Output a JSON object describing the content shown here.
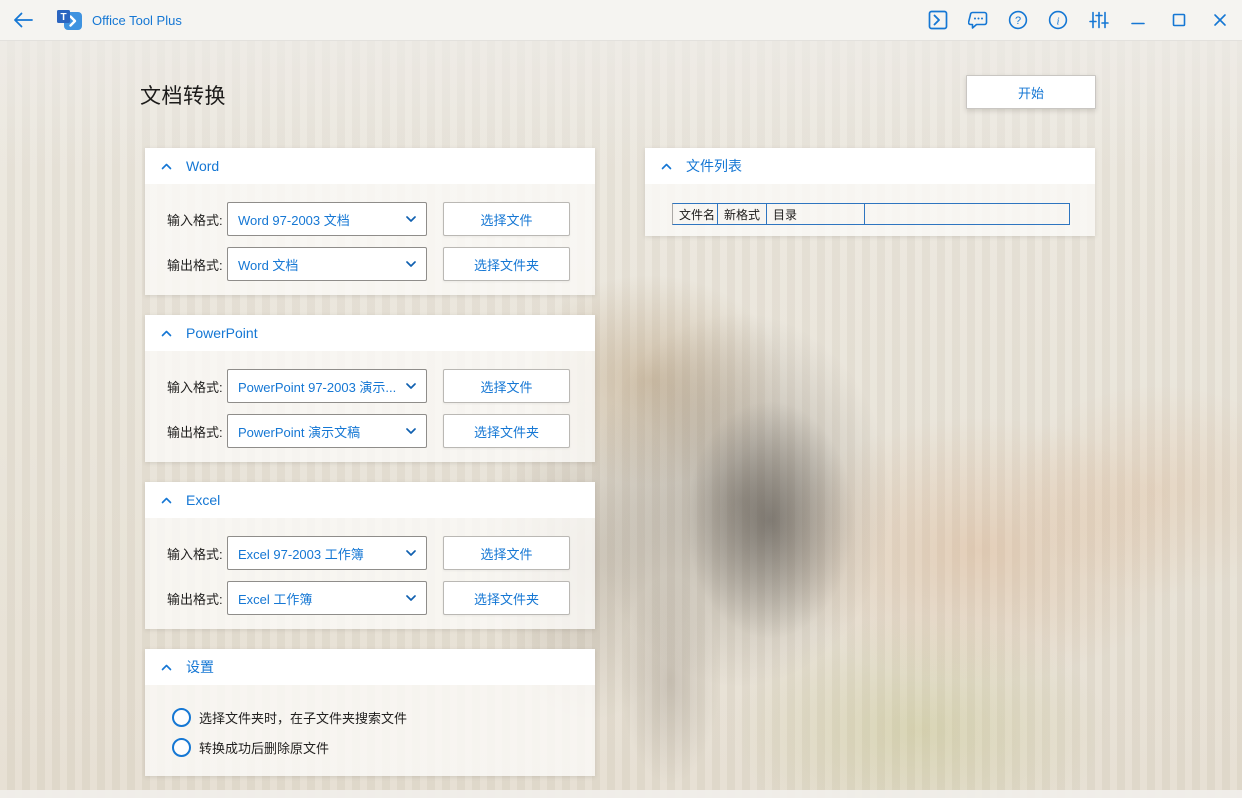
{
  "titlebar": {
    "app_title": "Office Tool Plus",
    "logo_letter": "T",
    "help_glyph": "?",
    "info_glyph": "i",
    "icons": [
      "back-icon",
      "console-icon",
      "feedback-icon",
      "help-icon",
      "about-icon",
      "settings-sliders-icon",
      "minimize-icon",
      "maximize-icon",
      "close-icon"
    ]
  },
  "page": {
    "title": "文档转换",
    "start_button": "开始"
  },
  "labels": {
    "input": "输入格式:",
    "output": "输出格式:",
    "select_file": "选择文件",
    "select_folder": "选择文件夹"
  },
  "sections": {
    "word": {
      "title": "Word",
      "input_value": "Word 97-2003 文档",
      "output_value": "Word 文档"
    },
    "powerpoint": {
      "title": "PowerPoint",
      "input_value": "PowerPoint 97-2003 演示...",
      "output_value": "PowerPoint 演示文稿"
    },
    "excel": {
      "title": "Excel",
      "input_value": "Excel 97-2003 工作簿",
      "output_value": "Excel 工作簿"
    },
    "settings": {
      "title": "设置",
      "options": [
        "选择文件夹时，在子文件夹搜索文件",
        "转换成功后删除原文件"
      ]
    },
    "file_list": {
      "title": "文件列表",
      "columns": [
        "文件名",
        "新格式",
        "目录"
      ]
    }
  },
  "colors": {
    "accent": "#1577d4",
    "table_border": "#2e75c0",
    "titlebar_bg": "#f5f4f1",
    "panel_header_bg": "#ffffff"
  }
}
